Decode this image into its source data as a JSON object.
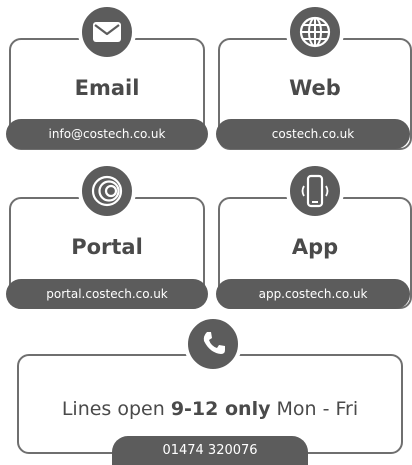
{
  "cards": [
    {
      "title": "Email",
      "value": "info@costech.co.uk",
      "icon": "envelope-icon"
    },
    {
      "title": "Web",
      "value": "costech.co.uk",
      "icon": "globe-icon"
    },
    {
      "title": "Portal",
      "value": "portal.costech.co.uk",
      "icon": "portal-icon"
    },
    {
      "title": "App",
      "value": "app.costech.co.uk",
      "icon": "mobile-phone-icon"
    }
  ],
  "phone": {
    "lines_prefix": "Lines open",
    "lines_hours": "9-12 only",
    "lines_suffix": "Mon - Fri",
    "number": "01474 320076",
    "icon": "phone-handset-icon"
  },
  "colors": {
    "primary": "#5c5c5c",
    "border": "#6f6f6f",
    "text": "#4a4a4a",
    "background": "#ffffff"
  }
}
